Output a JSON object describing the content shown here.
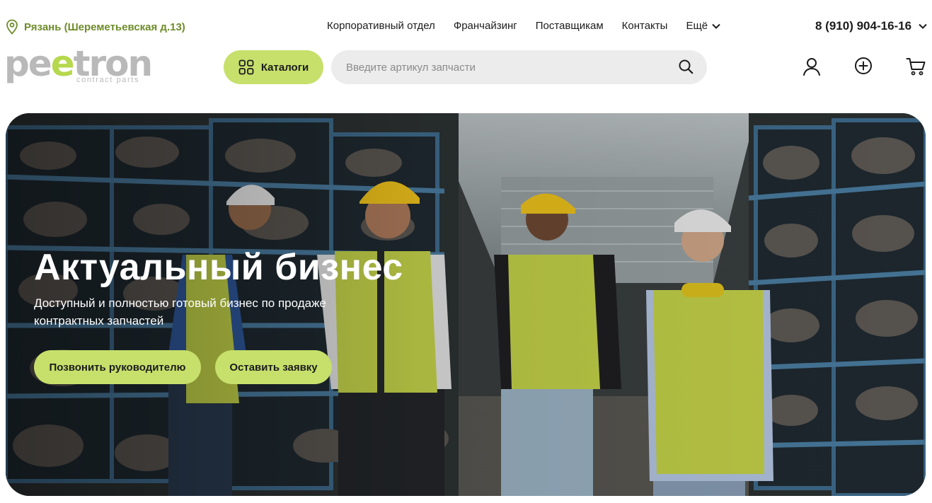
{
  "header": {
    "city": "Рязань (Шереметьевская д.13)",
    "nav": [
      "Корпоративный отдел",
      "Франчайзинг",
      "Поставщикам",
      "Контакты"
    ],
    "more_label": "Ещё",
    "phone": "8 (910) 904-16-16"
  },
  "logo": {
    "part1": "pe",
    "part2": "e",
    "part3": "tron",
    "sub": "contract parts"
  },
  "catalog_button": "Каталоги",
  "search": {
    "placeholder": "Введите артикул запчасти"
  },
  "icons": {
    "location": "map-pin-icon",
    "catalog": "grid-icon",
    "search": "search-icon",
    "account": "user-icon",
    "add": "plus-circle-icon",
    "cart": "cart-icon"
  },
  "colors": {
    "accent": "#c6e06b",
    "city_text": "#6e8c2a",
    "logo_gray": "#b9b9b9",
    "logo_green": "#b6d84e"
  },
  "hero": {
    "title": "Актуальный бизнес",
    "subtitle": "Доступный и полностью готовый бизнес по продаже контрактных запчастей",
    "button_call": "Позвонить руководителю",
    "button_request": "Оставить заявку"
  }
}
